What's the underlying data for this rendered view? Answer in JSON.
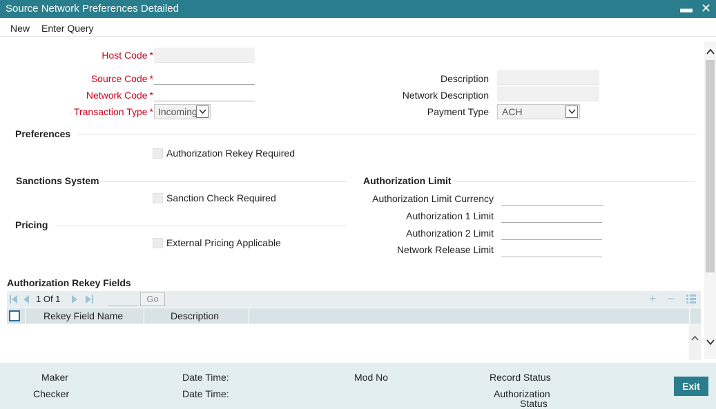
{
  "window": {
    "title": "Source Network Preferences Detailed",
    "minimize": "▬",
    "close": "✕"
  },
  "menu": {
    "new": "New",
    "enter_query": "Enter Query"
  },
  "form": {
    "host_code": {
      "label": "Host Code",
      "star": "*",
      "value": ""
    },
    "source_code": {
      "label": "Source Code",
      "star": "*",
      "value": ""
    },
    "network_code": {
      "label": "Network Code",
      "star": "*",
      "value": ""
    },
    "transaction_type": {
      "label": "Transaction Type",
      "star": "*",
      "value": "Incoming"
    },
    "description": {
      "label": "Description",
      "value": ""
    },
    "network_description": {
      "label": "Network Description",
      "value": ""
    },
    "payment_type": {
      "label": "Payment Type",
      "value": "ACH"
    }
  },
  "preferences": {
    "title": "Preferences",
    "auth_rekey": "Authorization Rekey Required"
  },
  "sanctions": {
    "title": "Sanctions System",
    "check": "Sanction Check Required"
  },
  "pricing": {
    "title": "Pricing",
    "external": "External Pricing Applicable"
  },
  "auth_limit": {
    "title": "Authorization Limit",
    "currency": "Authorization Limit Currency",
    "limit1": "Authorization 1 Limit",
    "limit2": "Authorization 2 Limit",
    "release": "Network Release Limit"
  },
  "rekey_grid": {
    "title": "Authorization Rekey Fields",
    "page": "1 Of 1",
    "go": "Go",
    "columns": [
      "Rekey Field Name",
      "Description"
    ]
  },
  "footer": {
    "maker": "Maker",
    "checker": "Checker",
    "date_time": "Date Time:",
    "mod_no": "Mod No",
    "record_status": "Record Status",
    "auth_status_1": "Authorization",
    "auth_status_2": "Status",
    "exit": "Exit"
  },
  "colors": {
    "accent": "#2a7d8c",
    "required": "#d0021b"
  }
}
